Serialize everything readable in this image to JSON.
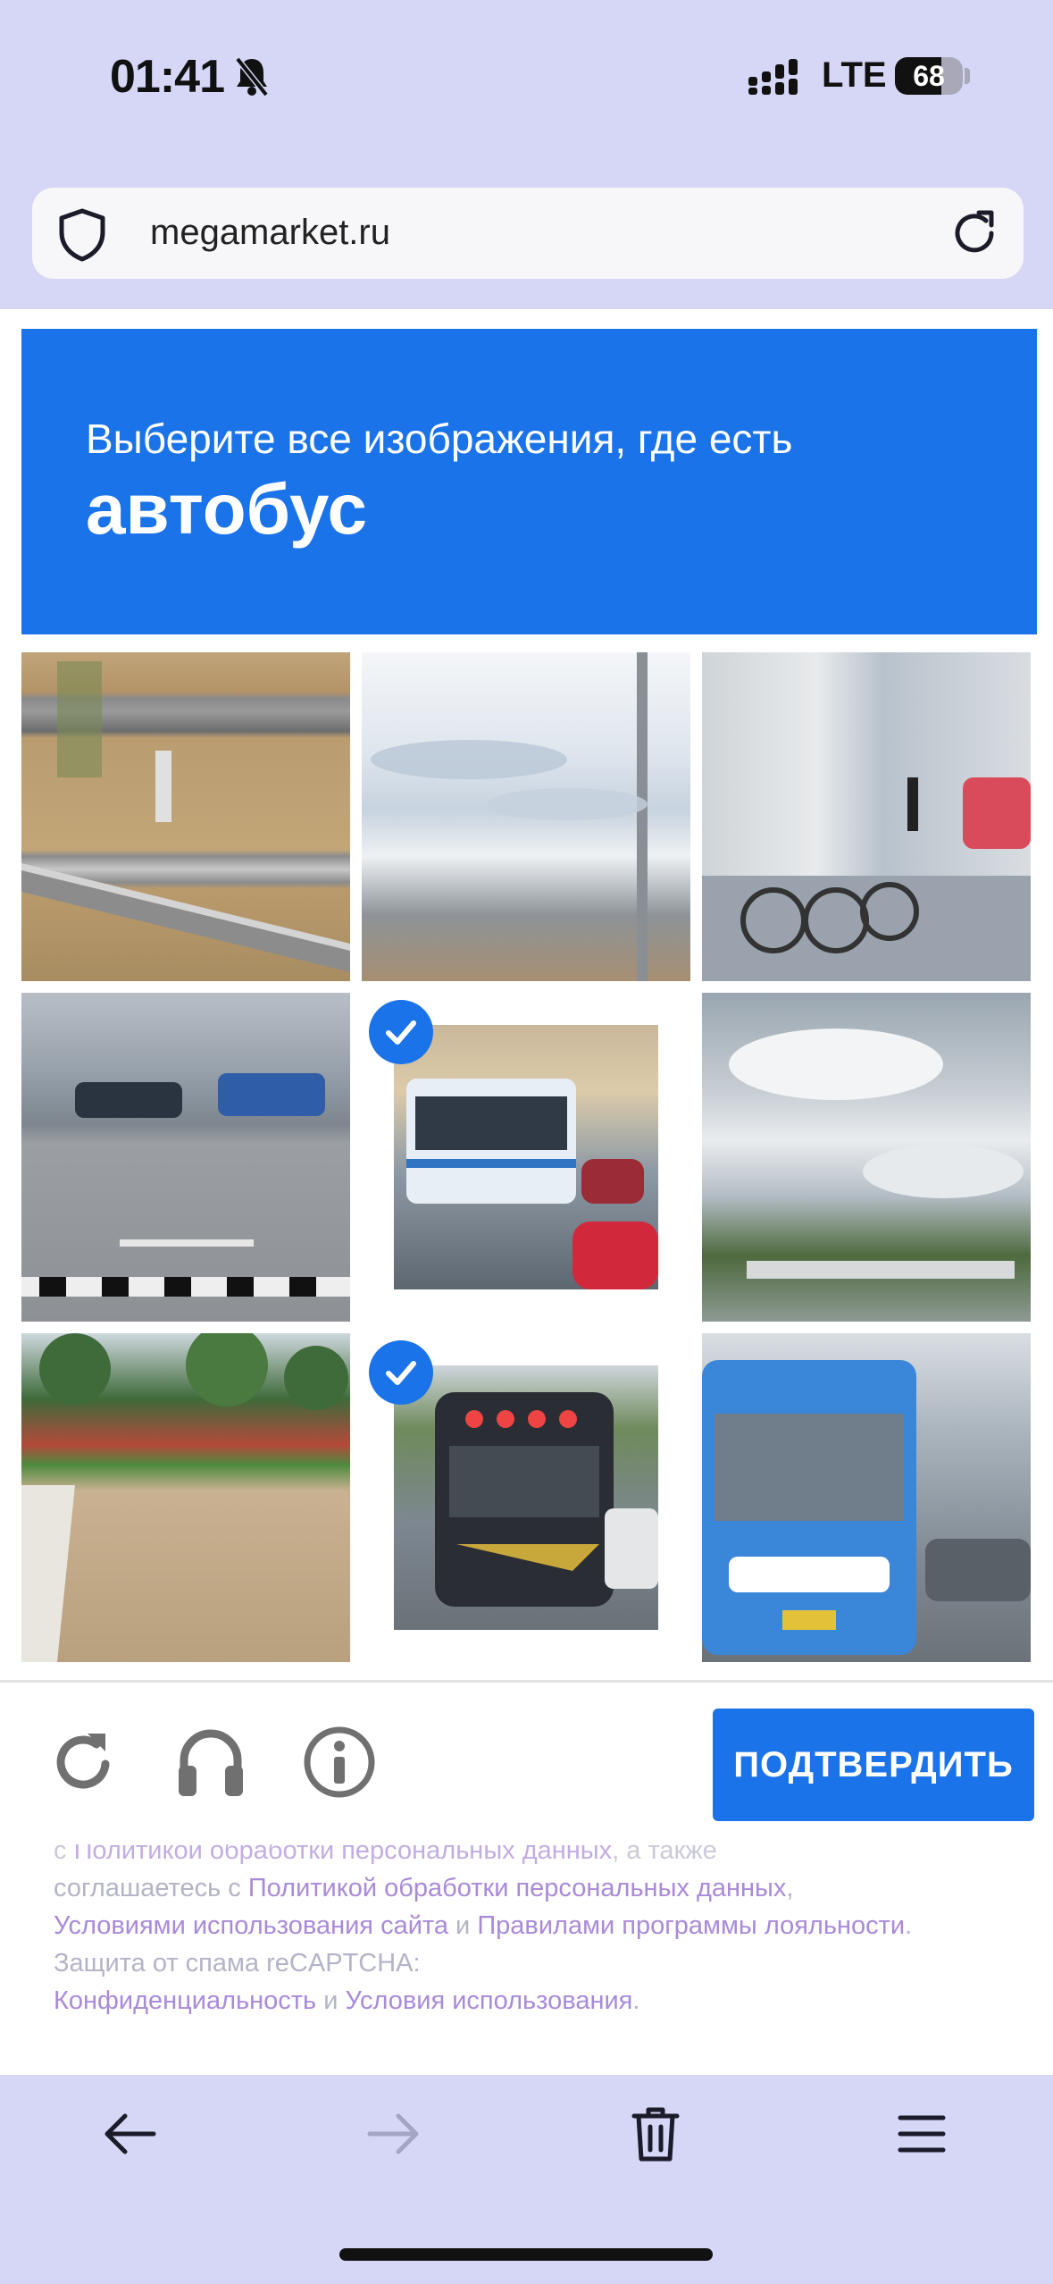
{
  "status_bar": {
    "time": "01:41",
    "network": "LTE",
    "battery": "68",
    "battery_level_percent": 68
  },
  "url_bar": {
    "url": "megamarket.ru"
  },
  "captcha": {
    "instruction": "Выберите все изображения, где есть",
    "target_object": "автобус",
    "verify_button": "ПОДТВЕРДИТЬ",
    "tiles": [
      {
        "subject": "road-guardrail",
        "selected": false
      },
      {
        "subject": "sky-pole",
        "selected": false
      },
      {
        "subject": "street-bicycles",
        "selected": false
      },
      {
        "subject": "street-cars",
        "selected": false
      },
      {
        "subject": "bus",
        "selected": true
      },
      {
        "subject": "clouds-trees",
        "selected": false
      },
      {
        "subject": "park-path",
        "selected": false
      },
      {
        "subject": "bus-front",
        "selected": true
      },
      {
        "subject": "blue-bus",
        "selected": false
      }
    ],
    "accent_color": "#1a73e8"
  },
  "legal": {
    "line1_prefix": "с ",
    "line1_link": "Политикой обработки персональных данных",
    "line1_suffix": ", а также",
    "t1": "соглашаетесь с ",
    "link1": "Политикой обработки персональных данных",
    "t2": ",",
    "link2": "Условиями использования сайта",
    "t3": " и ",
    "link3": "Правилами программы лояльности",
    "t4": ". Защита от спама reCAPTCHA:",
    "link4": "Конфиденциальность",
    "t5": " и ",
    "link5": "Условия использования",
    "t6": "."
  },
  "icons": {
    "url_bar": [
      "shield-icon",
      "reload-icon"
    ],
    "captcha_tools": [
      "reload-icon",
      "headphones-icon",
      "info-icon"
    ],
    "toolbar": [
      "back-arrow-icon",
      "forward-arrow-icon",
      "trash-icon",
      "menu-icon"
    ]
  }
}
